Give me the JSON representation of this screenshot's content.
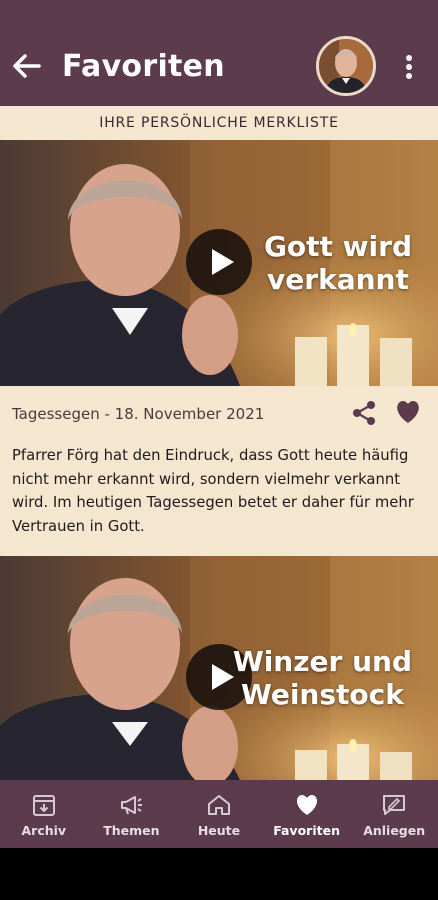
{
  "header": {
    "title": "Favoriten",
    "back_icon": "arrow-left-icon",
    "avatar": "profile-avatar",
    "more_icon": "more-vertical-icon"
  },
  "subheader": {
    "text": "IHRE PERSÖNLICHE MERKLISTE"
  },
  "cards": [
    {
      "video_title_line1": "Gott wird",
      "video_title_line2": "verkannt",
      "meta": "Tagessegen - 18. November 2021",
      "description": "Pfarrer Förg hat den Eindruck, dass Gott heute häufig nicht mehr erkannt wird, sondern vielmehr verkannt wird. Im heutigen Tagessegen betet er daher für mehr Vertrauen in Gott."
    },
    {
      "video_title_line1": "Winzer und",
      "video_title_line2": "Weinstock"
    }
  ],
  "nav": {
    "items": [
      {
        "label": "Archiv",
        "icon": "archive-icon"
      },
      {
        "label": "Themen",
        "icon": "megaphone-icon"
      },
      {
        "label": "Heute",
        "icon": "home-icon"
      },
      {
        "label": "Favoriten",
        "icon": "heart-icon",
        "active": true
      },
      {
        "label": "Anliegen",
        "icon": "message-edit-icon"
      }
    ]
  },
  "colors": {
    "primary": "#5b3b4c",
    "cream": "#f5e6d0",
    "text": "#1f1a1c"
  }
}
